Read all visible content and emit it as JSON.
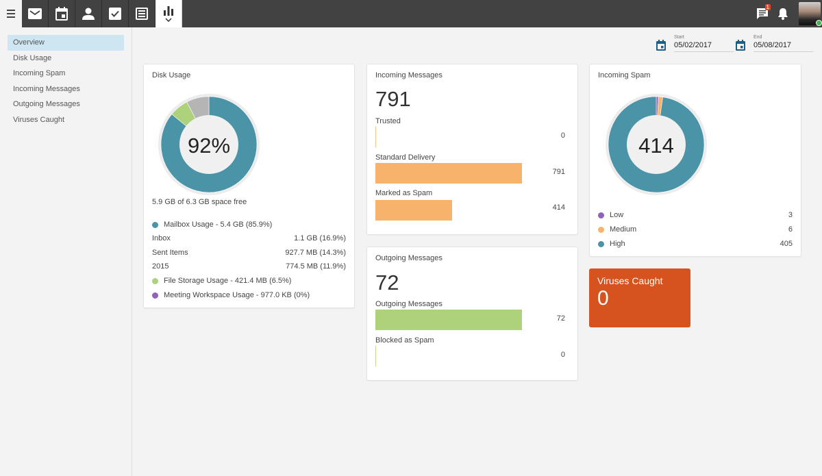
{
  "topbar": {
    "menu_icon": "hamburger-icon",
    "app_tabs": [
      {
        "name": "mail",
        "icon": "envelope-icon",
        "active": false
      },
      {
        "name": "calendar",
        "icon": "calendar-icon",
        "active": false
      },
      {
        "name": "contacts",
        "icon": "person-icon",
        "active": false
      },
      {
        "name": "tasks",
        "icon": "checkbox-icon",
        "active": false
      },
      {
        "name": "notes",
        "icon": "notes-icon",
        "active": false
      },
      {
        "name": "reports",
        "icon": "bar-chart-icon",
        "active": true
      }
    ],
    "chat_badge": "1",
    "notifications_icon": "bell-icon",
    "avatar_status": "online"
  },
  "sidebar": {
    "items": [
      {
        "label": "Overview",
        "active": true
      },
      {
        "label": "Disk Usage",
        "active": false
      },
      {
        "label": "Incoming Spam",
        "active": false
      },
      {
        "label": "Incoming Messages",
        "active": false
      },
      {
        "label": "Outgoing Messages",
        "active": false
      },
      {
        "label": "Viruses Caught",
        "active": false
      }
    ]
  },
  "date_range": {
    "start_label": "Start",
    "start_value": "05/02/2017",
    "end_label": "End",
    "end_value": "05/08/2017"
  },
  "colors": {
    "teal": "#4b94a8",
    "green": "#aed17c",
    "gray": "#b5b5b5",
    "purple": "#8e63b8",
    "orange": "#f7b36b",
    "virus_red": "#d6521f",
    "accent_blue": "#1b5f86"
  },
  "disk_usage": {
    "title": "Disk Usage",
    "center_label": "92%",
    "percent_used": 92,
    "free_text": "5.9 GB of 6.3 GB space free",
    "donut_segments": [
      {
        "name": "Mailbox Usage",
        "percent": 85.9,
        "color": "#4b94a8"
      },
      {
        "name": "File Storage Usage",
        "percent": 6.5,
        "color": "#aed17c"
      },
      {
        "name": "Free",
        "percent": 7.6,
        "color": "#b5b5b5"
      }
    ],
    "legend": [
      {
        "type": "dot",
        "color": "#4b94a8",
        "label": "Mailbox Usage - 5.4 GB (85.9%)",
        "value": ""
      },
      {
        "type": "plain",
        "label": "Inbox",
        "value": "1.1 GB (16.9%)"
      },
      {
        "type": "plain",
        "label": "Sent Items",
        "value": "927.7 MB (14.3%)"
      },
      {
        "type": "plain",
        "label": "2015",
        "value": "774.5 MB (11.9%)"
      },
      {
        "type": "dot",
        "color": "#aed17c",
        "label": "File Storage Usage - 421.4 MB (6.5%)",
        "value": ""
      },
      {
        "type": "dot",
        "color": "#8e63b8",
        "label": "Meeting Workspace Usage - 977.0 KB (0%)",
        "value": ""
      }
    ]
  },
  "incoming_messages": {
    "title": "Incoming Messages",
    "total": "791",
    "max": 791,
    "bars": [
      {
        "label": "Trusted",
        "value": 0,
        "display": "0",
        "color": "#f7b36b"
      },
      {
        "label": "Standard Delivery",
        "value": 791,
        "display": "791",
        "color": "#f7b36b"
      },
      {
        "label": "Marked as Spam",
        "value": 414,
        "display": "414",
        "color": "#f7b36b"
      }
    ]
  },
  "outgoing_messages": {
    "title": "Outgoing Messages",
    "total": "72",
    "max": 72,
    "bars": [
      {
        "label": "Outgoing Messages",
        "value": 72,
        "display": "72",
        "color": "#aed17c"
      },
      {
        "label": "Blocked as Spam",
        "value": 0,
        "display": "0",
        "color": "#aed17c"
      }
    ]
  },
  "incoming_spam": {
    "title": "Incoming Spam",
    "center_label": "414",
    "segments": [
      {
        "label": "Low",
        "value": 3,
        "display": "3",
        "color": "#8e63b8"
      },
      {
        "label": "Medium",
        "value": 6,
        "display": "6",
        "color": "#f7b36b"
      },
      {
        "label": "High",
        "value": 405,
        "display": "405",
        "color": "#4b94a8"
      }
    ]
  },
  "viruses_caught": {
    "title": "Viruses Caught",
    "value": "0"
  }
}
